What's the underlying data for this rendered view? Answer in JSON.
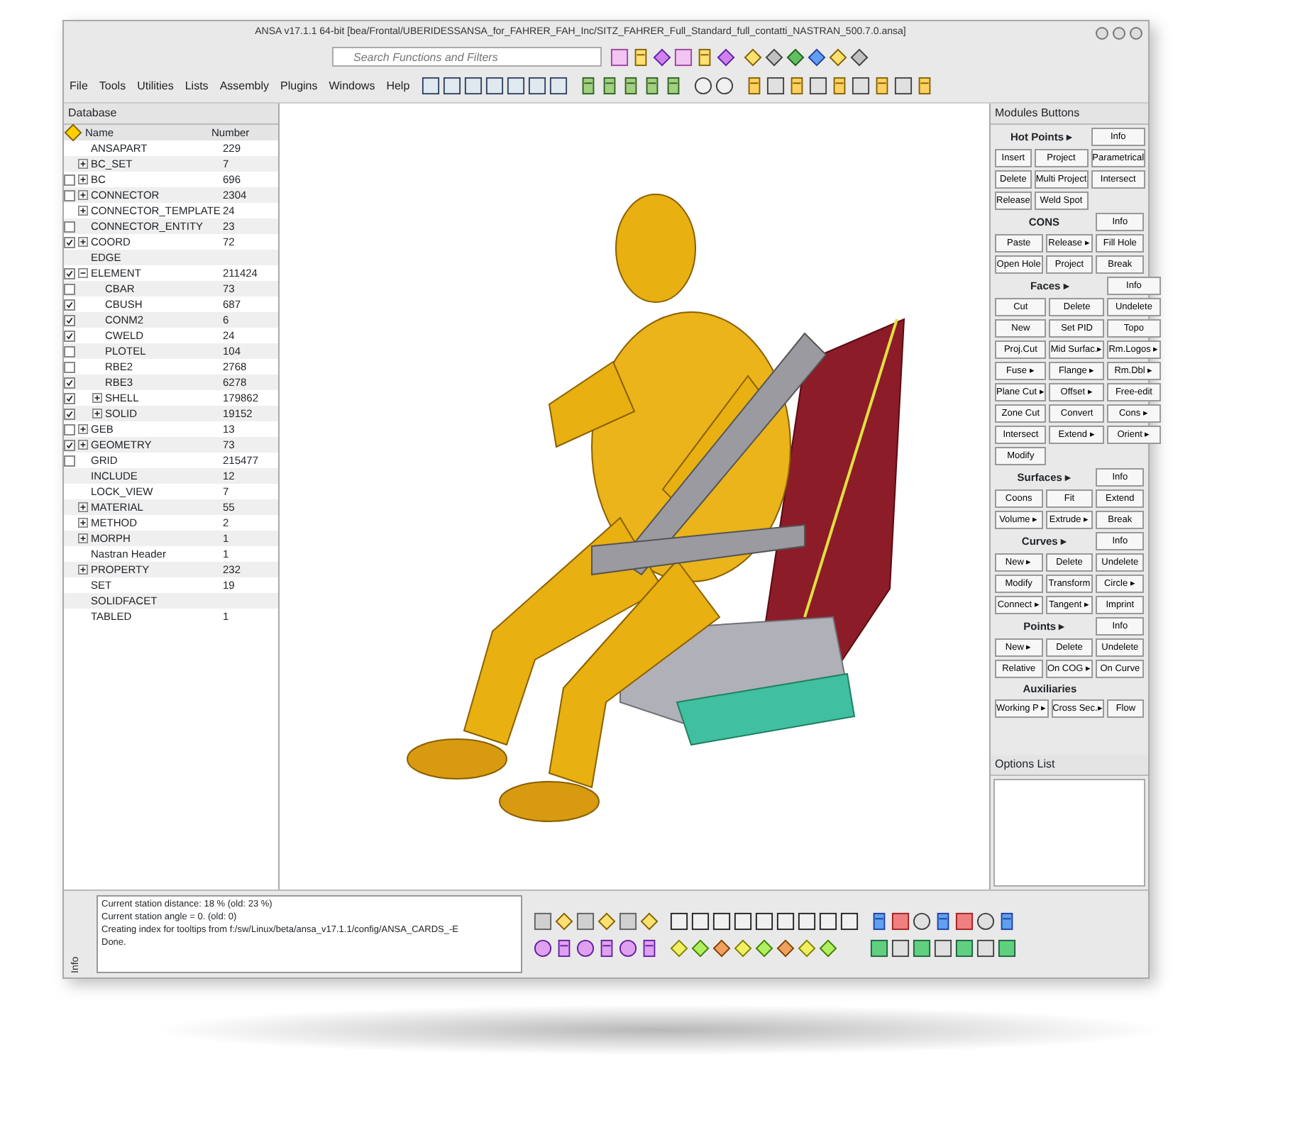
{
  "window": {
    "title": "ANSA v17.1.1 64-bit [bea/Frontal/UBERIDESSANSA_for_FAHRER_FAH_Inc/SITZ_FAHRER_Full_Standard_full_contatti_NASTRAN_500.7.0.ansa]"
  },
  "search": {
    "placeholder": "Search Functions and Filters"
  },
  "menu": [
    "File",
    "Tools",
    "Utilities",
    "Lists",
    "Assembly",
    "Plugins",
    "Windows",
    "Help"
  ],
  "database": {
    "title": "Database",
    "columns": [
      "Name",
      "Number"
    ],
    "items": [
      {
        "name": "ANSAPART",
        "number": "229"
      },
      {
        "name": "BC_SET",
        "number": "7",
        "expanded": false
      },
      {
        "name": "BC",
        "number": "696",
        "checked": false,
        "expanded": false
      },
      {
        "name": "CONNECTOR",
        "number": "2304",
        "checked": false,
        "expanded": false
      },
      {
        "name": "CONNECTOR_TEMPLATE",
        "number": "24",
        "expanded": false
      },
      {
        "name": "CONNECTOR_ENTITY",
        "number": "23",
        "checked": false
      },
      {
        "name": "COORD",
        "number": "72",
        "checked": true,
        "expanded": false
      },
      {
        "name": "EDGE"
      },
      {
        "name": "ELEMENT",
        "number": "211424",
        "checked": true,
        "expanded": true,
        "children": [
          {
            "name": "CBAR",
            "number": "73",
            "checked": false
          },
          {
            "name": "CBUSH",
            "number": "687",
            "checked": true
          },
          {
            "name": "CONM2",
            "number": "6",
            "checked": true
          },
          {
            "name": "CWELD",
            "number": "24",
            "checked": true
          },
          {
            "name": "PLOTEL",
            "number": "104",
            "checked": false
          },
          {
            "name": "RBE2",
            "number": "2768",
            "checked": false
          },
          {
            "name": "RBE3",
            "number": "6278",
            "checked": true
          },
          {
            "name": "SHELL",
            "number": "179862",
            "checked": true,
            "expanded": false
          },
          {
            "name": "SOLID",
            "number": "19152",
            "checked": true,
            "expanded": false
          }
        ]
      },
      {
        "name": "GEB",
        "number": "13",
        "checked": false,
        "expanded": false
      },
      {
        "name": "GEOMETRY",
        "number": "73",
        "checked": true,
        "expanded": false
      },
      {
        "name": "GRID",
        "number": "215477",
        "checked": false
      },
      {
        "name": "INCLUDE",
        "number": "12"
      },
      {
        "name": "LOCK_VIEW",
        "number": "7"
      },
      {
        "name": "MATERIAL",
        "number": "55",
        "expanded": false
      },
      {
        "name": "METHOD",
        "number": "2",
        "expanded": false
      },
      {
        "name": "MORPH",
        "number": "1",
        "expanded": false
      },
      {
        "name": "Nastran Header",
        "number": "1"
      },
      {
        "name": "PROPERTY",
        "number": "232",
        "expanded": false
      },
      {
        "name": "SET",
        "number": "19"
      },
      {
        "name": "SOLIDFACET"
      },
      {
        "name": "TABLED",
        "number": "1"
      }
    ]
  },
  "modules": {
    "title": "Modules Buttons",
    "sections": [
      {
        "title": "Hot Points ▸",
        "info": "Info",
        "rows": [
          [
            "Insert",
            "Project",
            "Parametrical"
          ],
          [
            "Delete",
            "Multi Project",
            "Intersect"
          ],
          [
            "Release",
            "Weld Spot"
          ]
        ]
      },
      {
        "title": "CONS",
        "info": "Info",
        "rows": [
          [
            "Paste",
            "Release ▸",
            "Fill Hole"
          ],
          [
            "Open Hole",
            "Project",
            "Break"
          ]
        ]
      },
      {
        "title": "Faces ▸",
        "info": "Info",
        "rows": [
          [
            "Cut",
            "Delete",
            "Undelete"
          ],
          [
            "New",
            "Set PID",
            "Topo"
          ],
          [
            "Proj.Cut",
            "Mid Surfac.▸",
            "Rm.Logos ▸"
          ],
          [
            "Fuse ▸",
            "Flange ▸",
            "Rm.Dbl ▸"
          ],
          [
            "Plane Cut ▸",
            "Offset ▸",
            "Free-edit"
          ],
          [
            "Zone Cut",
            "Convert",
            "Cons ▸"
          ],
          [
            "Intersect",
            "Extend ▸",
            "Orient ▸"
          ],
          [
            "Modify"
          ]
        ]
      },
      {
        "title": "Surfaces ▸",
        "info": "Info",
        "rows": [
          [
            "Coons",
            "Fit",
            "Extend"
          ],
          [
            "Volume ▸",
            "Extrude ▸",
            "Break"
          ]
        ]
      },
      {
        "title": "Curves ▸",
        "info": "Info",
        "rows": [
          [
            "New ▸",
            "Delete",
            "Undelete"
          ],
          [
            "Modify",
            "Transform",
            "Circle ▸"
          ],
          [
            "Connect ▸",
            "Tangent ▸",
            "Imprint"
          ]
        ]
      },
      {
        "title": "Points ▸",
        "info": "Info",
        "rows": [
          [
            "New ▸",
            "Delete",
            "Undelete"
          ],
          [
            "Relative",
            "On COG ▸",
            "On Curve"
          ]
        ]
      },
      {
        "title": "Auxiliaries",
        "rows": [
          [
            "Working P ▸",
            "Cross Sec.▸",
            "Flow"
          ]
        ]
      }
    ]
  },
  "options_list": {
    "title": "Options List"
  },
  "console": {
    "label": "Info",
    "lines": [
      "Current station distance: 18 % (old: 23 %)",
      "Current station angle = 0. (old: 0)",
      "Creating index for tooltips from f:/sw/Linux/beta/ansa_v17.1.1/config/ANSA_CARDS_-E",
      "Done."
    ]
  }
}
